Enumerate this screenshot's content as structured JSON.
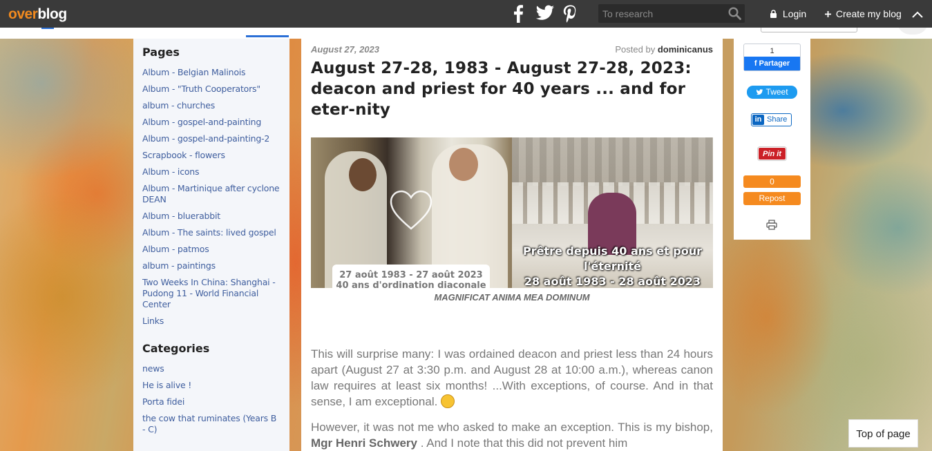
{
  "topbar": {
    "logo_over": "over",
    "logo_blog": "blog",
    "search_placeholder": "To research",
    "login_label": "Login",
    "create_label": "Create my blog"
  },
  "sidebar": {
    "pages_heading": "Pages",
    "pages": [
      "Album - Belgian Malinois",
      "Album - \"Truth Cooperators\"",
      "album - churches",
      "Album - gospel-and-painting",
      "Album - gospel-and-painting-2",
      "Scrapbook - flowers",
      "Album - icons",
      "Album - Martinique after cyclone DEAN",
      "Album - bluerabbit",
      "Album - The saints: lived gospel",
      "Album - patmos",
      "album - paintings",
      "Two Weeks In China: Shanghai - Pudong 11 - World Financial Center",
      "Links"
    ],
    "categories_heading": "Categories",
    "categories": [
      "news",
      "He is alive !",
      "Porta fidei",
      "the cow that ruminates (Years B - C)"
    ]
  },
  "article": {
    "date": "August 27, 2023",
    "posted_by_prefix": "Posted by ",
    "author": "dominicanus",
    "title": "August 27-28, 1983 - August 27-28, 2023: deacon and priest for 40 years ... and for eter-nity",
    "image_caption_left_line1": "27 août 1983 - 27 août 2023",
    "image_caption_left_line2": "40 ans d'ordination diaconale",
    "image_caption_right_line1": "Prêtre depuis 40 ans et pour",
    "image_caption_right_line2": "l'éternité",
    "image_caption_right_line3": "28 août 1983 - 28 août 2023",
    "figure_caption": "MAGNIFICAT ANIMA MEA DOMINUM",
    "paragraph1": "This will surprise many: I was ordained deacon and priest less than 24 hours apart (August 27 at 3:30 p.m. and August 28 at 10:00 a.m.), whereas canon law requires at least six months! ...With exceptions, of course. And in that sense, I am exceptional.",
    "paragraph2_start": "However, it was not me who asked to make an exception. This is my bishop, ",
    "paragraph2_bold": "Mgr Henri Schwery",
    "paragraph2_end": " . And I note that this did not prevent him"
  },
  "share": {
    "fb_count": "1",
    "fb_label": "Partager",
    "tweet_label": "Tweet",
    "linkedin_label": "Share",
    "pinit_label": "Pin it",
    "repost_count": "0",
    "repost_label": "Repost"
  },
  "footer": {
    "top_of_page": "Top of page"
  },
  "colors": {
    "topbar_bg": "#3a3a3a",
    "logo_orange": "#f18a1f",
    "link_blue": "#3f5e9e",
    "repost_orange": "#f58a1f"
  },
  "icons": {
    "facebook": "facebook-icon",
    "twitter": "twitter-icon",
    "pinterest": "pinterest-icon",
    "search": "search-icon",
    "lock": "lock-icon",
    "plus": "plus-icon",
    "chevron": "chevron-up-icon",
    "print": "print-icon",
    "heart": "heart-icon"
  }
}
